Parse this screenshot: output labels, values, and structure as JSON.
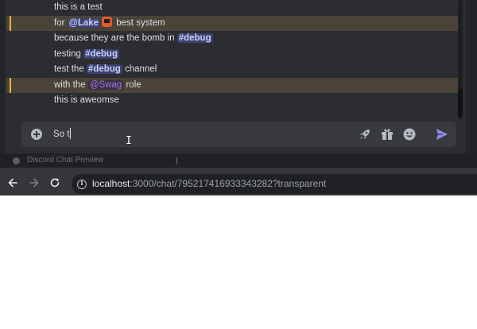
{
  "messages": [
    {
      "parts": [
        {
          "type": "text",
          "text": "this is a test"
        }
      ],
      "highlight": false
    },
    {
      "parts": [
        {
          "type": "text",
          "text": "for "
        },
        {
          "type": "mention",
          "text": "@Lake"
        },
        {
          "type": "emoji",
          "name": "train-emoji"
        },
        {
          "type": "text",
          "text": " best system"
        }
      ],
      "highlight": true
    },
    {
      "parts": [
        {
          "type": "text",
          "text": "because they are the bomb in "
        },
        {
          "type": "channel",
          "text": "#debug"
        }
      ],
      "highlight": false
    },
    {
      "parts": [
        {
          "type": "text",
          "text": "testing "
        },
        {
          "type": "channel",
          "text": "#debug"
        }
      ],
      "highlight": false
    },
    {
      "parts": [
        {
          "type": "text",
          "text": "test the "
        },
        {
          "type": "channel",
          "text": "#debug"
        },
        {
          "type": "text",
          "text": " channel"
        }
      ],
      "highlight": false
    },
    {
      "parts": [
        {
          "type": "text",
          "text": "with the "
        },
        {
          "type": "role",
          "text": "@Swag"
        },
        {
          "type": "text",
          "text": " role"
        }
      ],
      "highlight": true
    },
    {
      "parts": [
        {
          "type": "text",
          "text": "this is aweomse"
        }
      ],
      "highlight": false
    }
  ],
  "composer": {
    "value": "So t",
    "icons": [
      "add-icon",
      "rocket-icon",
      "gift-icon",
      "emoji-icon",
      "send-icon"
    ]
  },
  "browser": {
    "tab_title": "Discord Chat Preview",
    "url_host": "localhost",
    "url_rest": ":3000/chat/795217416933343282?transparent"
  },
  "colors": {
    "mention_bg": "#3d4270",
    "role_color": "#a07bd1",
    "highlight_bg": "#4a4337",
    "highlight_bar": "#f0b232",
    "send": "#8c8ff2"
  }
}
